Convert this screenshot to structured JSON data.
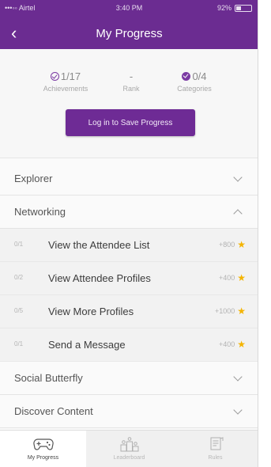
{
  "status_bar": {
    "carrier": "•••◦◦ Airtel",
    "time": "3:40 PM",
    "battery": "92%"
  },
  "header": {
    "title": "My Progress",
    "back_icon": "chevron-left-icon"
  },
  "stats": {
    "achievements": {
      "value": "1/17",
      "label": "Achievements"
    },
    "rank": {
      "value": "-",
      "label": "Rank"
    },
    "categories": {
      "value": "0/4",
      "label": "Categories"
    }
  },
  "login_button": "Log in to Save Progress",
  "sections": [
    {
      "title": "Explorer",
      "expanded": false
    },
    {
      "title": "Networking",
      "expanded": true
    },
    {
      "title": "Social Butterfly",
      "expanded": false
    },
    {
      "title": "Discover Content",
      "expanded": false
    }
  ],
  "networking_items": [
    {
      "count": "0/1",
      "name": "View the Attendee List",
      "points": "+800"
    },
    {
      "count": "0/2",
      "name": "View Attendee Profiles",
      "points": "+400"
    },
    {
      "count": "0/5",
      "name": "View More Profiles",
      "points": "+1000"
    },
    {
      "count": "0/1",
      "name": "Send a Message",
      "points": "+400"
    }
  ],
  "tabs": [
    {
      "label": "My Progress",
      "icon": "gamepad-icon",
      "active": true
    },
    {
      "label": "Leaderboard",
      "icon": "podium-icon",
      "active": false
    },
    {
      "label": "Rules",
      "icon": "rules-icon",
      "active": false
    }
  ],
  "colors": {
    "brand": "#6b2c91",
    "star": "#f4b400"
  }
}
